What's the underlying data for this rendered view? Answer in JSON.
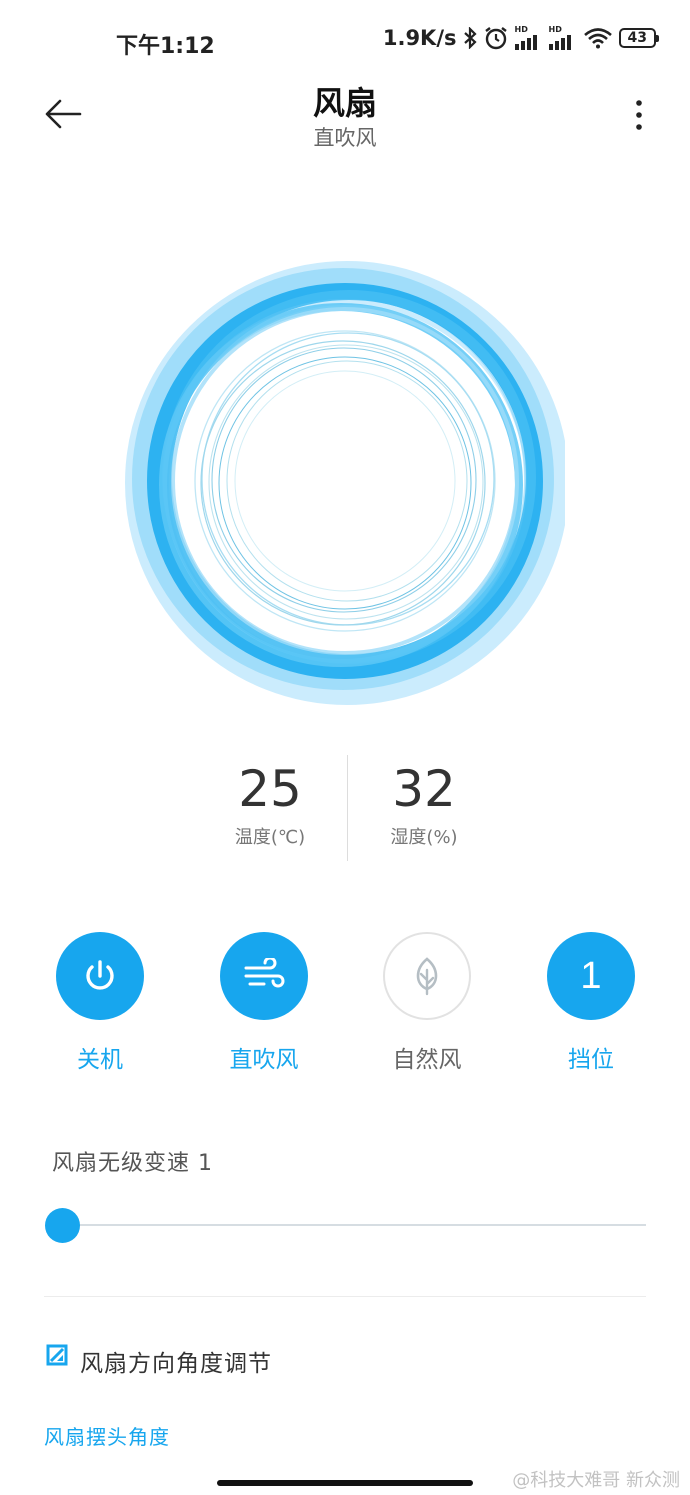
{
  "status_bar": {
    "time": "下午1:12",
    "network_speed": "1.9K/s",
    "signal_hd_1": "HD",
    "signal_hd_2": "HD",
    "battery": "43",
    "icons": [
      "bluetooth-icon",
      "alarm-icon",
      "signal-icon",
      "signal-icon",
      "wifi-icon",
      "battery-icon"
    ]
  },
  "header": {
    "title": "风扇",
    "subtitle": "直吹风",
    "back_icon": "arrow-left-icon",
    "more_icon": "more-vertical-icon"
  },
  "sensors": {
    "temperature": {
      "value": "25",
      "label": "温度(℃)"
    },
    "humidity": {
      "value": "32",
      "label": "湿度(%)"
    }
  },
  "modes": [
    {
      "label": "关机",
      "icon": "power-icon",
      "active": true
    },
    {
      "label": "直吹风",
      "icon": "wind-icon",
      "active": true
    },
    {
      "label": "自然风",
      "icon": "leaf-icon",
      "active": false
    },
    {
      "label": "挡位",
      "value": "1",
      "active": true
    }
  ],
  "speed_slider": {
    "title": "风扇无级变速 1",
    "level_fraction": 0.0
  },
  "direction": {
    "title": "风扇方向角度调节",
    "swing_link": "风扇摆头角度"
  },
  "watermark": "@科技大难哥 新众测",
  "colors": {
    "accent": "#17a6ee",
    "ring_light": "#8fd8fb",
    "inactive_border": "#e2e2e2"
  }
}
